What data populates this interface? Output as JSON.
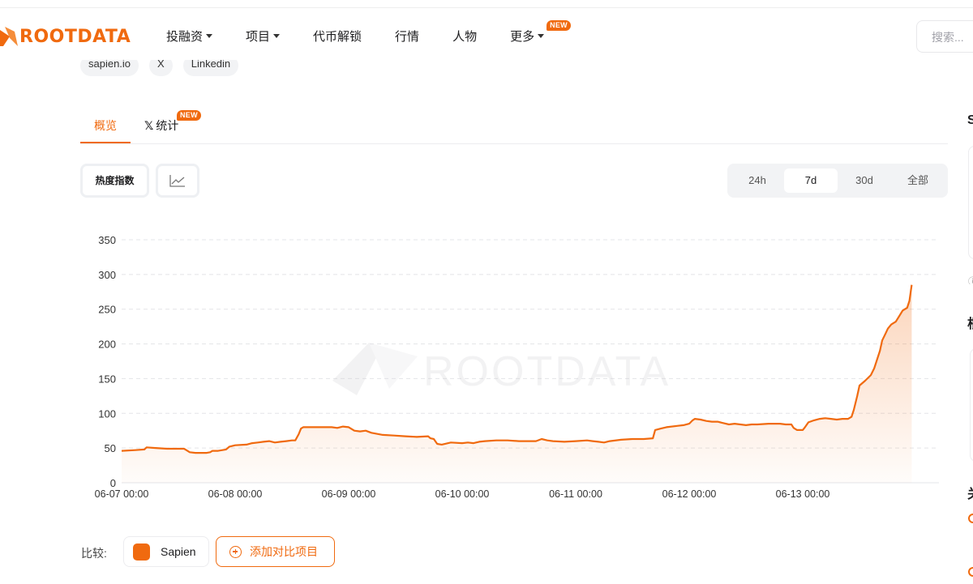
{
  "brand": {
    "logo_text": "ROOTDATA",
    "accent": "#f06a0f"
  },
  "nav": {
    "items": [
      {
        "label": "投融资",
        "has_dropdown": true
      },
      {
        "label": "项目",
        "has_dropdown": true
      },
      {
        "label": "代币解锁",
        "has_dropdown": false
      },
      {
        "label": "行情",
        "has_dropdown": false
      },
      {
        "label": "人物",
        "has_dropdown": false
      },
      {
        "label": "更多",
        "has_dropdown": true,
        "badge": "NEW"
      }
    ],
    "search_placeholder": "搜索..."
  },
  "social": {
    "chips": [
      "sapien.io",
      "X",
      "Linkedin"
    ]
  },
  "tabs": {
    "overview": "概览",
    "x_stats": "统计",
    "x_stats_badge": "NEW"
  },
  "controls": {
    "metric_label": "热度指数",
    "ranges": [
      "24h",
      "7d",
      "30d",
      "全部"
    ],
    "active_range": "7d"
  },
  "chart_data": {
    "type": "area",
    "watermark": "ROOTDATA",
    "ylim": [
      0,
      350
    ],
    "y_ticks": [
      0,
      50,
      100,
      150,
      200,
      250,
      300,
      350
    ],
    "x_tick_labels": [
      "06-07 00:00",
      "06-08 00:00",
      "06-09 00:00",
      "06-10 00:00",
      "06-11 00:00",
      "06-12 00:00",
      "06-13 00:00"
    ],
    "x_range_days": [
      0,
      7.2
    ],
    "grid": true,
    "series": [
      {
        "name": "Sapien",
        "color": "#f06a0f",
        "points": [
          [
            0.0,
            46
          ],
          [
            0.12,
            47
          ],
          [
            0.2,
            48
          ],
          [
            0.22,
            51
          ],
          [
            0.3,
            50
          ],
          [
            0.4,
            49
          ],
          [
            0.5,
            49
          ],
          [
            0.55,
            49
          ],
          [
            0.57,
            47
          ],
          [
            0.6,
            44
          ],
          [
            0.65,
            43
          ],
          [
            0.75,
            43
          ],
          [
            0.78,
            44
          ],
          [
            0.8,
            46
          ],
          [
            0.85,
            46
          ],
          [
            0.92,
            48
          ],
          [
            0.95,
            52
          ],
          [
            1.0,
            54
          ],
          [
            1.1,
            55
          ],
          [
            1.15,
            57
          ],
          [
            1.2,
            58
          ],
          [
            1.25,
            59
          ],
          [
            1.3,
            60
          ],
          [
            1.35,
            58
          ],
          [
            1.4,
            59
          ],
          [
            1.45,
            60
          ],
          [
            1.5,
            61
          ],
          [
            1.53,
            61
          ],
          [
            1.56,
            70
          ],
          [
            1.58,
            78
          ],
          [
            1.6,
            80
          ],
          [
            1.7,
            80
          ],
          [
            1.8,
            80
          ],
          [
            1.85,
            80
          ],
          [
            1.9,
            79
          ],
          [
            1.95,
            81
          ],
          [
            2.0,
            80
          ],
          [
            2.05,
            75
          ],
          [
            2.1,
            74
          ],
          [
            2.15,
            75
          ],
          [
            2.2,
            72
          ],
          [
            2.3,
            69
          ],
          [
            2.4,
            68
          ],
          [
            2.5,
            67
          ],
          [
            2.6,
            66
          ],
          [
            2.7,
            67
          ],
          [
            2.72,
            64
          ],
          [
            2.75,
            63
          ],
          [
            2.78,
            56
          ],
          [
            2.82,
            55
          ],
          [
            2.9,
            58
          ],
          [
            3.0,
            57
          ],
          [
            3.05,
            58
          ],
          [
            3.1,
            57
          ],
          [
            3.15,
            59
          ],
          [
            3.2,
            60
          ],
          [
            3.3,
            61
          ],
          [
            3.4,
            61
          ],
          [
            3.5,
            60
          ],
          [
            3.6,
            60
          ],
          [
            3.65,
            60
          ],
          [
            3.7,
            63
          ],
          [
            3.75,
            61
          ],
          [
            3.8,
            60
          ],
          [
            3.9,
            59
          ],
          [
            4.0,
            60
          ],
          [
            4.1,
            61
          ],
          [
            4.15,
            60
          ],
          [
            4.2,
            59
          ],
          [
            4.25,
            58
          ],
          [
            4.3,
            60
          ],
          [
            4.4,
            62
          ],
          [
            4.5,
            63
          ],
          [
            4.6,
            63
          ],
          [
            4.68,
            64
          ],
          [
            4.7,
            76
          ],
          [
            4.75,
            78
          ],
          [
            4.8,
            80
          ],
          [
            4.9,
            82
          ],
          [
            4.95,
            83
          ],
          [
            5.0,
            85
          ],
          [
            5.03,
            90
          ],
          [
            5.05,
            92
          ],
          [
            5.1,
            91
          ],
          [
            5.15,
            89
          ],
          [
            5.2,
            88
          ],
          [
            5.25,
            88
          ],
          [
            5.3,
            86
          ],
          [
            5.35,
            84
          ],
          [
            5.4,
            85
          ],
          [
            5.45,
            84
          ],
          [
            5.5,
            83
          ],
          [
            5.55,
            84
          ],
          [
            5.6,
            84
          ],
          [
            5.7,
            85
          ],
          [
            5.8,
            85
          ],
          [
            5.85,
            84
          ],
          [
            5.9,
            84
          ],
          [
            5.92,
            79
          ],
          [
            5.95,
            76
          ],
          [
            6.0,
            76
          ],
          [
            6.02,
            80
          ],
          [
            6.05,
            87
          ],
          [
            6.1,
            90
          ],
          [
            6.15,
            92
          ],
          [
            6.2,
            93
          ],
          [
            6.25,
            92
          ],
          [
            6.3,
            91
          ],
          [
            6.35,
            92
          ],
          [
            6.4,
            92
          ],
          [
            6.43,
            95
          ],
          [
            6.45,
            105
          ],
          [
            6.48,
            125
          ],
          [
            6.5,
            140
          ],
          [
            6.55,
            147
          ],
          [
            6.6,
            155
          ],
          [
            6.63,
            165
          ],
          [
            6.65,
            175
          ],
          [
            6.68,
            190
          ],
          [
            6.7,
            205
          ],
          [
            6.73,
            215
          ],
          [
            6.75,
            222
          ],
          [
            6.78,
            228
          ],
          [
            6.82,
            232
          ],
          [
            6.85,
            240
          ],
          [
            6.88,
            248
          ],
          [
            6.92,
            252
          ],
          [
            6.94,
            262
          ],
          [
            6.96,
            285
          ]
        ]
      }
    ]
  },
  "compare": {
    "label": "比较:",
    "project": "Sapien",
    "add_label": "添加对比项目"
  },
  "sidebar_fragments": [
    "S",
    "根",
    "关"
  ]
}
